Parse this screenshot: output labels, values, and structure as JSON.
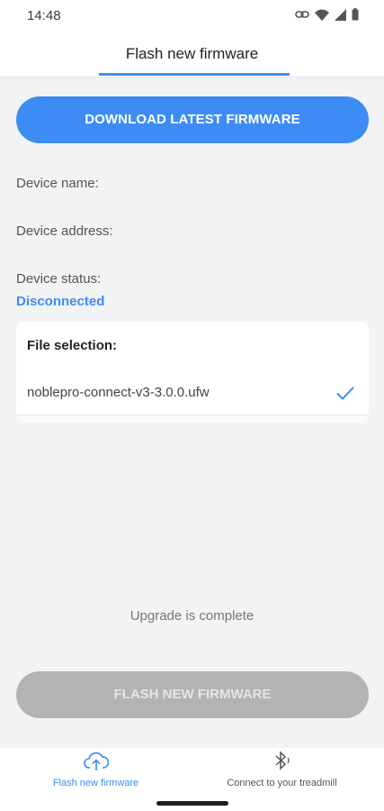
{
  "status_bar": {
    "time": "14:48",
    "icons": [
      "link-icon",
      "wifi-icon",
      "signal-icon",
      "battery-icon"
    ]
  },
  "header": {
    "title": "Flash new firmware",
    "accent_color": "#3e8ef7"
  },
  "download_button": {
    "label": "DOWNLOAD LATEST FIRMWARE",
    "color": "#3d8cf6"
  },
  "device": {
    "name_label": "Device name:",
    "address_label": "Device address:",
    "status_label": "Device status:",
    "status_value": "Disconnected"
  },
  "file_selection": {
    "title": "File selection:",
    "files": [
      {
        "name": "noblepro-connect-v3-3.0.0.ufw",
        "selected": true
      }
    ]
  },
  "upgrade_status": "Upgrade is complete",
  "flash_button": {
    "label": "FLASH NEW FIRMWARE",
    "enabled": false
  },
  "bottom_nav": {
    "items": [
      {
        "label": "Flash new firmware",
        "icon": "cloud-upload-icon",
        "active": true
      },
      {
        "label": "Connect to your treadmill",
        "icon": "bluetooth-icon",
        "active": false
      }
    ]
  }
}
